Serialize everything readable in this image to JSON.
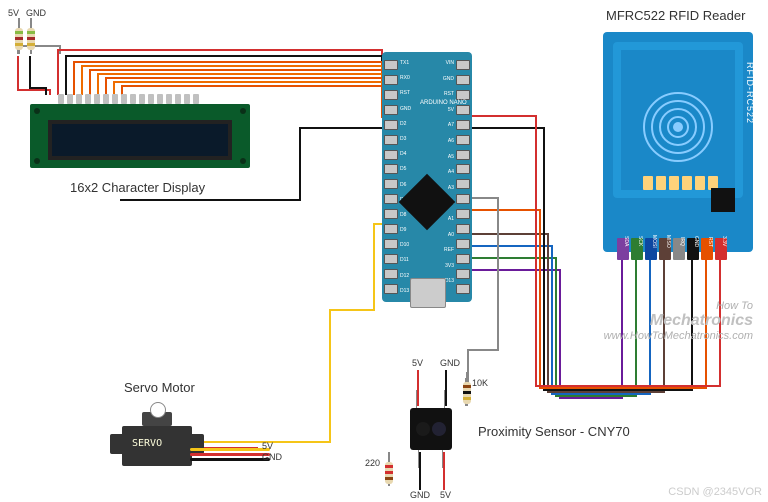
{
  "labels": {
    "lcd": "16x2 Character Display",
    "rfid_title": "MFRC522 RFID Reader",
    "rfid_side": "RFID-RC522",
    "servo_title": "Servo Motor",
    "servo_body": "SERVO",
    "cny_title": "Proximity Sensor - CNY70",
    "nano_title": "ARDUINO\nNANO",
    "csdn": "CSDN @2345VOR",
    "watermark_brand": "Mechatronics",
    "watermark_prefix": "How To",
    "watermark_url": "www.HowToMechatronics.com"
  },
  "power": {
    "topleft_5v": "5V",
    "topleft_gnd": "GND",
    "servo_5v": "5V",
    "servo_gnd": "GND",
    "cny_top_5v": "5V",
    "cny_top_gnd": "GND",
    "cny_bot_5v": "5V",
    "cny_bot_gnd": "GND",
    "cny_r1": "10K",
    "cny_r2": "220"
  },
  "arduino_pins_left": [
    "TX1",
    "RX0",
    "RST",
    "GND",
    "D2",
    "D3",
    "D4",
    "D5",
    "D6",
    "D7",
    "D8",
    "D9",
    "D10",
    "D11",
    "D12",
    "D13"
  ],
  "arduino_pins_right": [
    "VIN",
    "GND",
    "RST",
    "5V",
    "A7",
    "A6",
    "A5",
    "A4",
    "A3",
    "A2",
    "A1",
    "A0",
    "REF",
    "3V3",
    "D13",
    ""
  ],
  "rfid_pins": [
    "SDA",
    "SCK",
    "MOSI",
    "MISO",
    "IRQ",
    "GND",
    "RST",
    "3.3V"
  ],
  "rfid_pin_colors": [
    "#7c3fa0",
    "#2e7d32",
    "#0d47a1",
    "#5d4037",
    "#888888",
    "#111111",
    "#e65100",
    "#d32f2f"
  ],
  "wire_colors": {
    "yellow": "#f5c518",
    "red": "#d32f2f",
    "black": "#111111",
    "orange": "#e65100",
    "orange2": "#ef6c00",
    "green": "#2e7d32",
    "blue": "#1565c0",
    "purple": "#6a1b9a",
    "brown": "#5d4037",
    "grey": "#616161",
    "darkred": "#b71c1c"
  }
}
